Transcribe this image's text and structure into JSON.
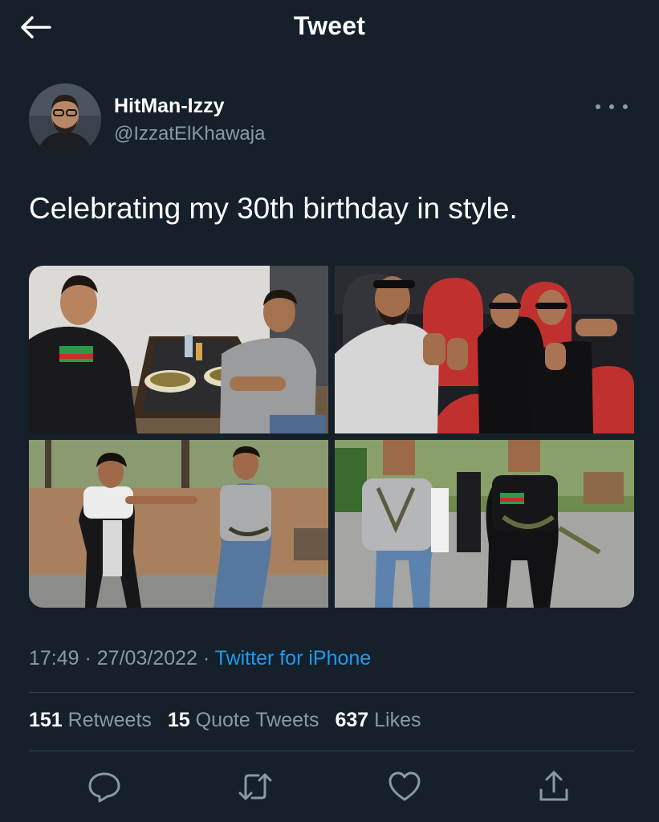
{
  "header": {
    "title": "Tweet",
    "back_icon": "arrow-left-icon"
  },
  "author": {
    "name": "HitMan-Izzy",
    "handle": "@IzzatElKhawaja"
  },
  "tweet": {
    "text": "Celebrating my 30th birthday in style."
  },
  "meta": {
    "time": "17:49",
    "sep1": " · ",
    "date": "27/03/2022",
    "sep2": " · ",
    "source": "Twitter for iPhone"
  },
  "stats": {
    "retweets": {
      "count": "151",
      "label": "Retweets"
    },
    "quotes": {
      "count": "15",
      "label": "Quote Tweets"
    },
    "likes": {
      "count": "637",
      "label": "Likes"
    }
  },
  "colors": {
    "background": "#15202b",
    "muted": "#8b98a5",
    "accent": "#1d9bf0",
    "divider": "#38444d"
  },
  "actions": [
    "reply-icon",
    "retweet-icon",
    "like-icon",
    "share-icon"
  ]
}
